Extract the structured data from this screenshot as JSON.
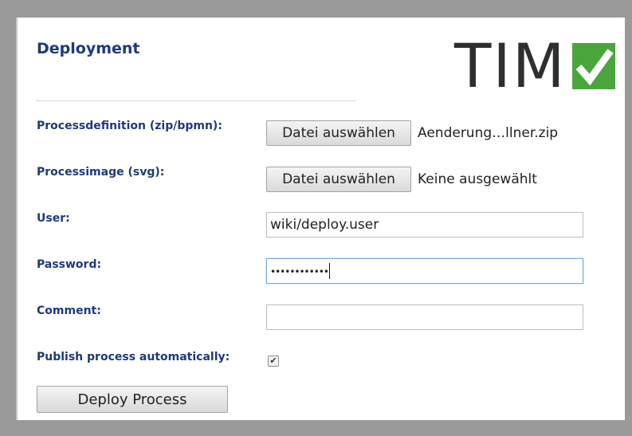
{
  "form": {
    "title": "Deployment",
    "logo_text": "TIM",
    "fields": {
      "processdefinition": {
        "label": "Processdefinition (zip/bpmn):",
        "button": "Datei auswählen",
        "file": "Aenderung…llner.zip"
      },
      "processimage": {
        "label": "Processimage (svg):",
        "button": "Datei auswählen",
        "file": "Keine ausgewählt"
      },
      "user": {
        "label": "User:",
        "value": "wiki/deploy.user"
      },
      "password": {
        "label": "Password:",
        "value": "••••••••••••"
      },
      "comment": {
        "label": "Comment:",
        "value": ""
      },
      "publish": {
        "label": "Publish process automatically:",
        "checked": true,
        "mark": "✔"
      }
    },
    "deploy_button": "Deploy Process"
  },
  "colors": {
    "label": "#1f3a78",
    "logo_green": "#4aa63c",
    "frame": "#9a9a9a"
  }
}
